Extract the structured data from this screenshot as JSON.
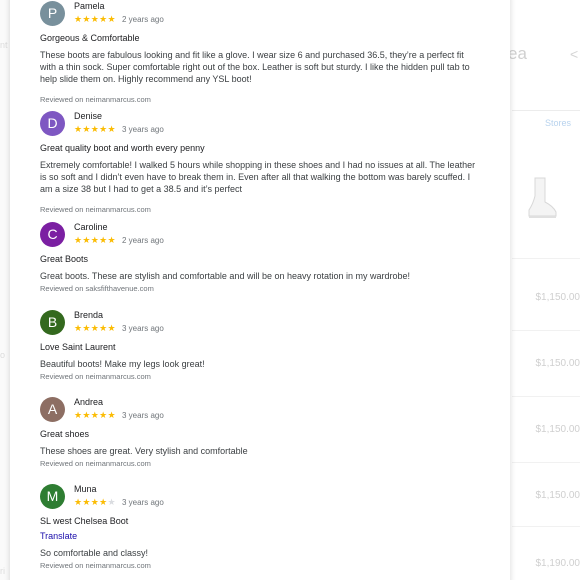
{
  "backdrop": {
    "title_fragment": "ea",
    "share_glyph": "<",
    "stores_tab": "Stores",
    "prices": [
      "$1,150.00",
      "$1,150.00",
      "$1,150.00",
      "$1,150.00",
      "$1,150.00",
      "$1,190.00"
    ],
    "left_fragments": [
      "nt",
      "o",
      "ri"
    ]
  },
  "reviews": [
    {
      "initial": "P",
      "name": "Pamela",
      "rating": 5,
      "stars": "★★★★★",
      "age": "2 years ago",
      "headline": "Gorgeous & Comfortable",
      "body": "These boots are fabulous looking and fit like a glove. I wear size 6 and purchased 36.5, they’re a perfect fit with a thin sock. Super comfortable right out of the box. Leather is soft but sturdy. I like the hidden pull tab to help slide them on. Highly recommend any YSL boot!",
      "source": "Reviewed on neimanmarcus.com",
      "avatar_color": "#78909c"
    },
    {
      "initial": "D",
      "name": "Denise",
      "rating": 5,
      "stars": "★★★★★",
      "age": "3 years ago",
      "headline": "Great quality boot and worth every penny",
      "body": "Extremely comfortable! I walked 5 hours while shopping in these shoes and I had no issues at all. The leather is so soft and I didn’t even have to break them in. Even after all that walking the bottom was barely scuffed. I am a size 38 but I had to get a 38.5 and it’s perfect",
      "source": "Reviewed on neimanmarcus.com",
      "avatar_color": "#7e57c2"
    },
    {
      "initial": "C",
      "name": "Caroline",
      "rating": 5,
      "stars": "★★★★★",
      "age": "2 years ago",
      "headline": "Great Boots",
      "body": "Great boots. These are stylish and comfortable and will be on heavy rotation in my wardrobe!",
      "source": "Reviewed on saksfifthavenue.com",
      "avatar_color": "#7b1fa2"
    },
    {
      "initial": "B",
      "name": "Brenda",
      "rating": 5,
      "stars": "★★★★★",
      "age": "3 years ago",
      "headline": "Love Saint Laurent",
      "body": "Beautiful boots! Make my legs look great!",
      "source": "Reviewed on neimanmarcus.com",
      "avatar_color": "#33691e"
    },
    {
      "initial": "A",
      "name": "Andrea",
      "rating": 5,
      "stars": "★★★★★",
      "age": "3 years ago",
      "headline": "Great shoes",
      "body": "These shoes are great. Very stylish and comfortable",
      "source": "Reviewed on neimanmarcus.com",
      "avatar_color": "#8d6e63"
    },
    {
      "initial": "M",
      "name": "Muna",
      "rating": 4,
      "stars_on": "★★★★",
      "stars_off": "★",
      "age": "3 years ago",
      "headline": "SL west Chelsea Boot",
      "translate": "Translate",
      "body": "So comfortable and classy!",
      "source": "Reviewed on neimanmarcus.com",
      "avatar_color": "#2e7d32"
    }
  ],
  "colors": {
    "star": "#fbbc04",
    "star_off": "#dadce0",
    "link": "#1a0dab",
    "muted": "#70757a"
  }
}
